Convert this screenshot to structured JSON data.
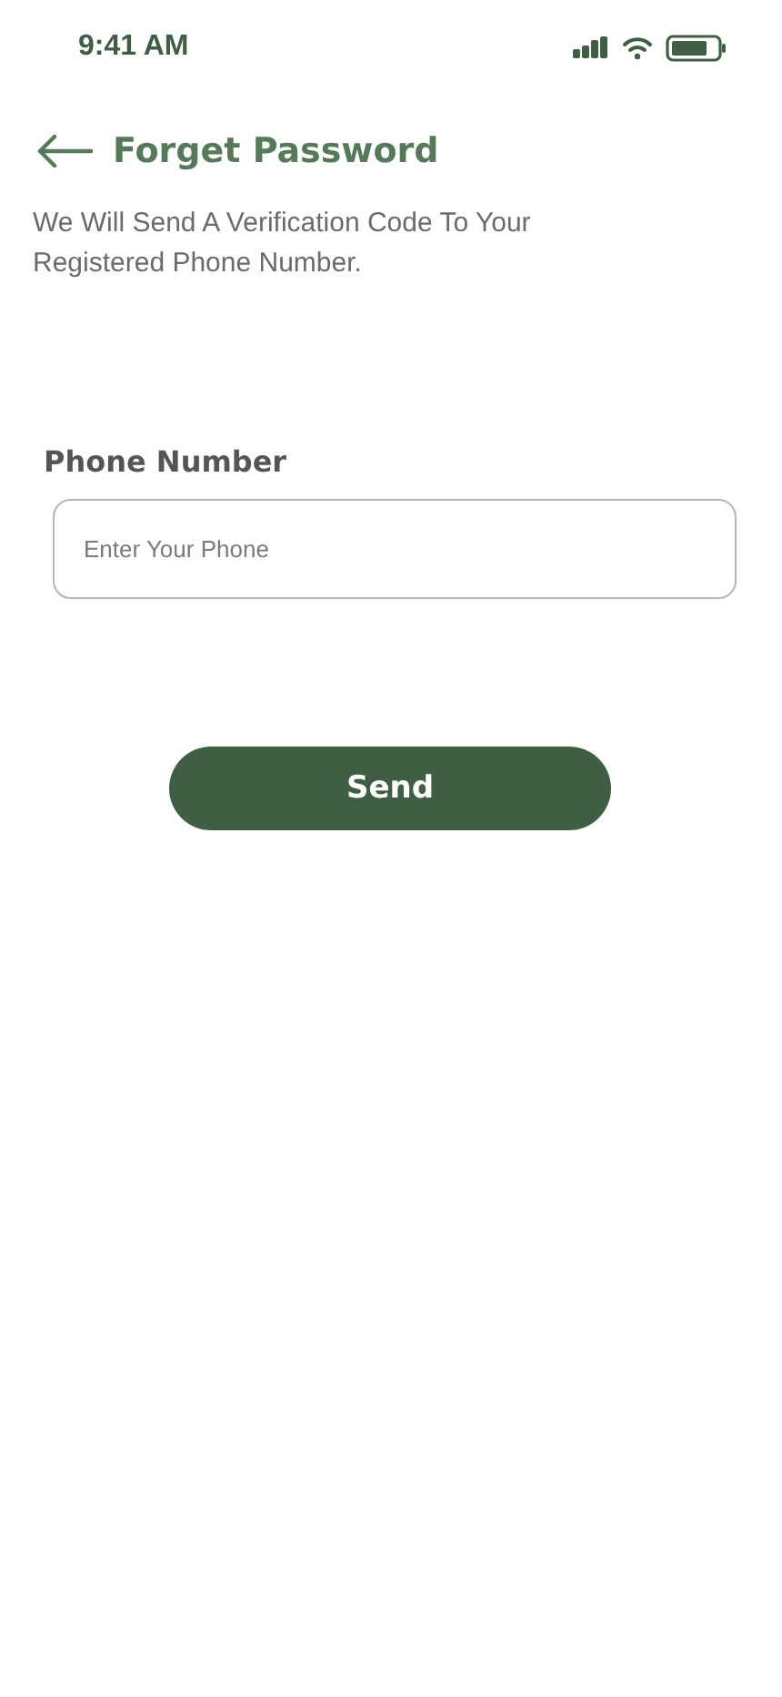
{
  "status_bar": {
    "time": "9:41 AM"
  },
  "header": {
    "title": "Forget Password"
  },
  "description": "We Will Send A Verification Code To Your Registered Phone Number.",
  "phone_field": {
    "label": "Phone Number",
    "placeholder": "Enter Your Phone"
  },
  "send_button": {
    "label": "Send"
  }
}
